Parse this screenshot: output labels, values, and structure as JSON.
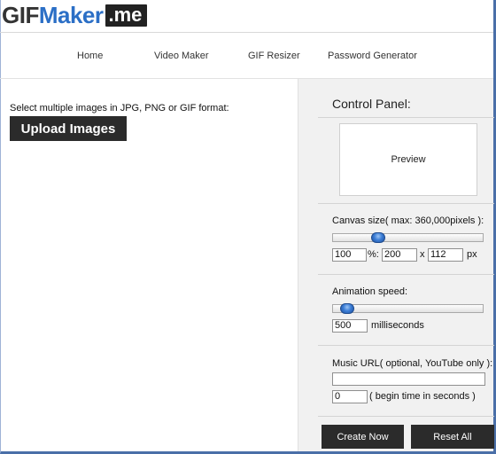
{
  "header": {
    "logo_gif": "GIF",
    "logo_maker": "Maker",
    "logo_me": ".me"
  },
  "nav": {
    "items": [
      "Home",
      "Video Maker",
      "GIF Resizer",
      "Password Generator"
    ]
  },
  "upload": {
    "instructions": "Select multiple images in JPG, PNG or GIF format:",
    "button_label": "Upload Images"
  },
  "control_panel": {
    "title": "Control Panel:",
    "preview_label": "Preview",
    "canvas": {
      "label": "Canvas size( max: 360,000pixels ):",
      "slider_position": 0.28,
      "percent_value": "100",
      "percent_suffix": "%:",
      "width_value": "200",
      "times": "x",
      "height_value": "112",
      "unit": "px"
    },
    "speed": {
      "label": "Animation speed:",
      "slider_position": 0.05,
      "value": "500",
      "unit": "milliseconds"
    },
    "music": {
      "label": "Music URL( optional, YouTube only ):",
      "url_value": "",
      "begin_value": "0",
      "begin_label": "( begin time in seconds )"
    },
    "create_label": "Create Now",
    "reset_label": "Reset All"
  },
  "colors": {
    "brand_blue": "#2b6fc6",
    "button_dark": "#2b2b2b",
    "panel_bg": "#f1f1f1",
    "frame_border": "#4a6fa8"
  }
}
